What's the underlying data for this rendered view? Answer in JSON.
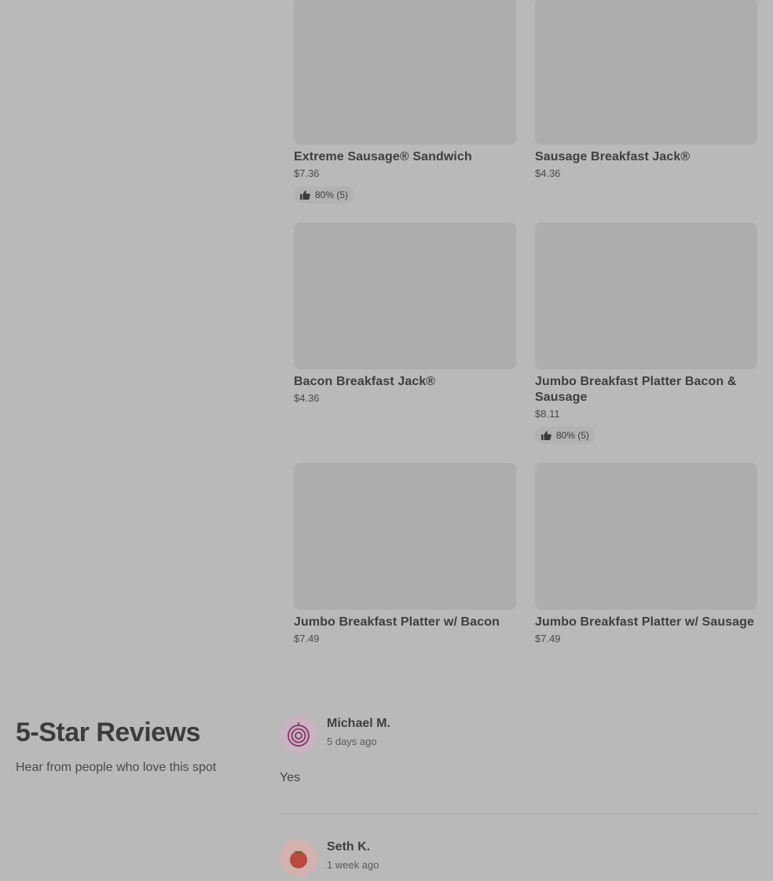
{
  "menu_items": [
    {
      "name": "Extreme Sausage® Sandwich",
      "price": "$7.36",
      "rating": "80% (5)"
    },
    {
      "name": "Sausage Breakfast Jack®",
      "price": "$4.36",
      "rating": null
    },
    {
      "name": "Bacon Breakfast Jack®",
      "price": "$4.36",
      "rating": null
    },
    {
      "name": "Jumbo Breakfast Platter Bacon & Sausage",
      "price": "$8.11",
      "rating": "80% (5)"
    },
    {
      "name": "Jumbo Breakfast Platter w/ Bacon",
      "price": "$7.49",
      "rating": null
    },
    {
      "name": "Jumbo Breakfast Platter w/ Sausage",
      "price": "$7.49",
      "rating": null
    }
  ],
  "reviews_section": {
    "title": "5-Star Reviews",
    "subtitle": "Hear from people who love this spot"
  },
  "reviews": [
    {
      "name": "Michael M.",
      "time": "5 days ago",
      "text": "Yes",
      "avatar_icon": "onion-icon",
      "avatar_color": "#c9a2b6"
    },
    {
      "name": "Seth K.",
      "time": "1 week ago",
      "text": "",
      "avatar_icon": "tomato-icon",
      "avatar_color": "#d9a8a2"
    }
  ],
  "icons": {
    "rating": "thumbs-up-icon"
  }
}
